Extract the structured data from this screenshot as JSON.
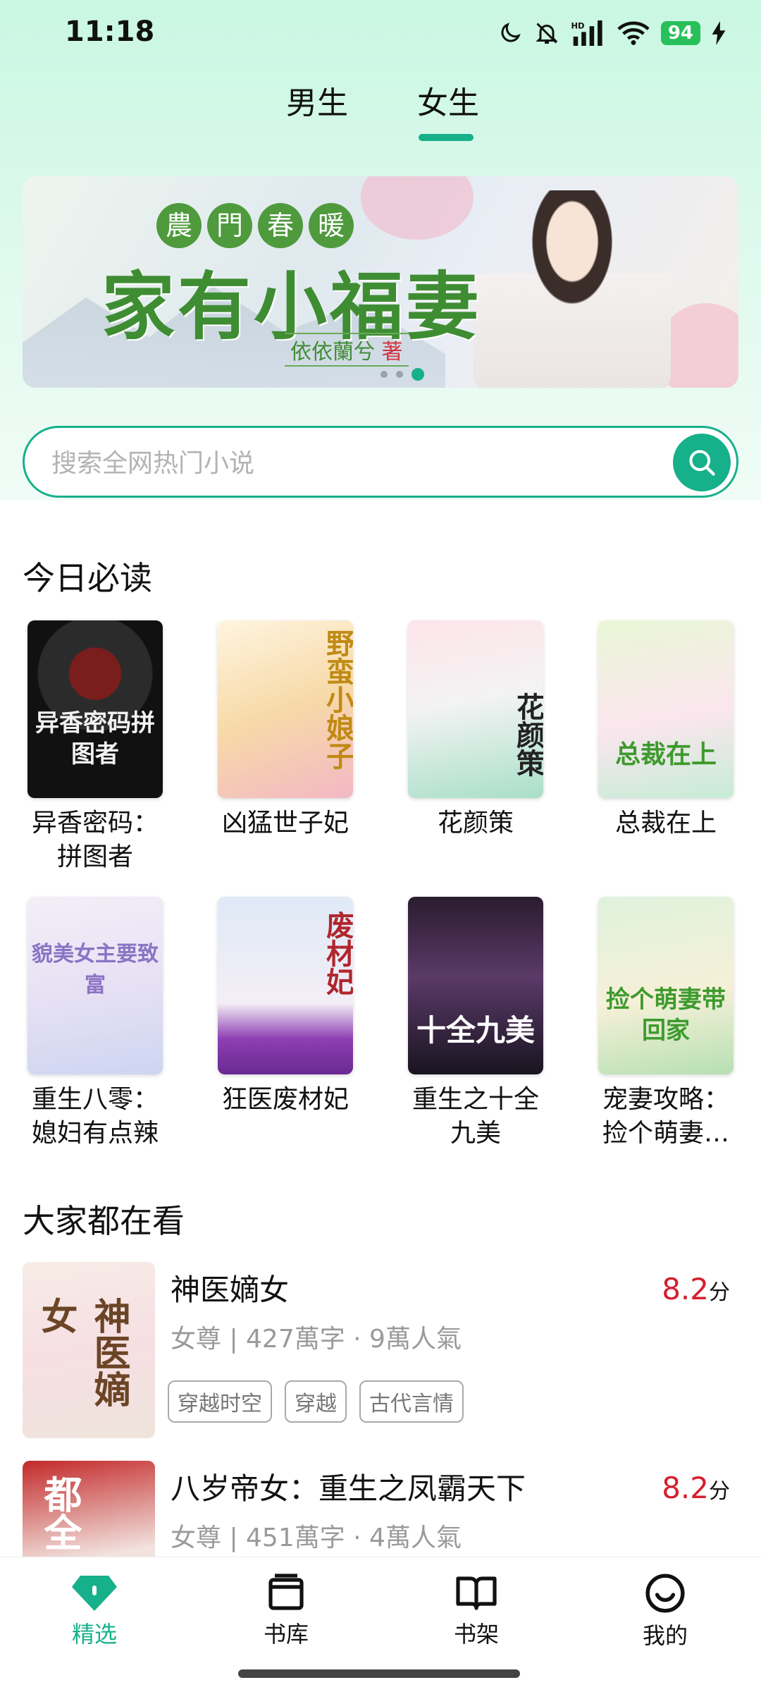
{
  "status_bar": {
    "time": "11:18",
    "battery": "94"
  },
  "gender_tabs": [
    {
      "label": "男生"
    },
    {
      "label": "女生"
    }
  ],
  "banner": {
    "subtitle_chars": [
      "農",
      "門",
      "春",
      "暖"
    ],
    "title": "家有小福妻",
    "author": "依依蘭兮",
    "author_suffix": "著"
  },
  "search": {
    "placeholder": "搜索全网热门小说"
  },
  "section_today": {
    "title": "今日必读"
  },
  "today_books": [
    {
      "title_line1": "异香密码：",
      "title_line2": "拼图者",
      "cover_text": "异香密码拼图者"
    },
    {
      "title_line1": "凶猛世子妃",
      "title_line2": "",
      "cover_text": "野蛮小娘子"
    },
    {
      "title_line1": "花颜策",
      "title_line2": "",
      "cover_text": "花颜策"
    },
    {
      "title_line1": "总裁在上",
      "title_line2": "",
      "cover_text": "总裁在上"
    },
    {
      "title_line1": "重生八零：",
      "title_line2": "媳妇有点辣",
      "cover_text": "貌美女主要致富"
    },
    {
      "title_line1": "狂医废材妃",
      "title_line2": "",
      "cover_text": "废材妃"
    },
    {
      "title_line1": "重生之十全",
      "title_line2": "九美",
      "cover_text": "十全九美"
    },
    {
      "title_line1": "宠妻攻略：",
      "title_line2": "捡个萌妻…",
      "cover_text": "捡个萌妻带回家"
    }
  ],
  "section_popular": {
    "title": "大家都在看"
  },
  "popular_books": [
    {
      "title": "神医嫡女",
      "meta": "女尊 | 427萬字 · 9萬人氣",
      "score": "8.2",
      "score_unit": "分",
      "tags": [
        "穿越时空",
        "穿越",
        "古代言情"
      ],
      "cover_text": "神医嫡女"
    },
    {
      "title": "八岁帝女：重生之凤霸天下",
      "meta": "女尊 | 451萬字 · 4萬人氣",
      "score": "8.2",
      "score_unit": "分",
      "tags": [],
      "cover_text": "都全"
    }
  ],
  "bottom_nav": [
    {
      "label": "精选",
      "icon": "diamond-icon",
      "active": true
    },
    {
      "label": "书库",
      "icon": "library-icon",
      "active": false
    },
    {
      "label": "书架",
      "icon": "open-book-icon",
      "active": false
    },
    {
      "label": "我的",
      "icon": "smile-icon",
      "active": false
    }
  ],
  "colors": {
    "accent": "#16b08a",
    "score": "#d51f2e",
    "battery": "#27c05a"
  }
}
